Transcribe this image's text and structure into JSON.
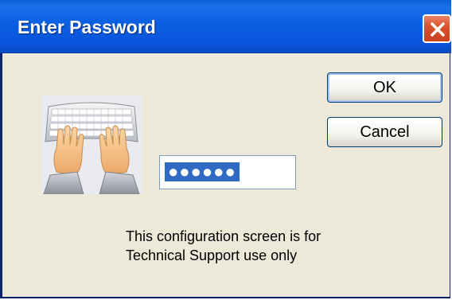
{
  "window": {
    "title": "Enter Password"
  },
  "icons": {
    "close": "close-icon",
    "main": "keyboard-hands-icon"
  },
  "buttons": {
    "ok_label": "OK",
    "cancel_label": "Cancel"
  },
  "password": {
    "value": "●●●●●●"
  },
  "message": {
    "line1": "This configuration screen is for",
    "line2": "Technical Support use only"
  },
  "colors": {
    "titlebar": "#0A5FD8",
    "close": "#D9532E",
    "face": "#ECE9D8",
    "selection": "#316AC5"
  }
}
